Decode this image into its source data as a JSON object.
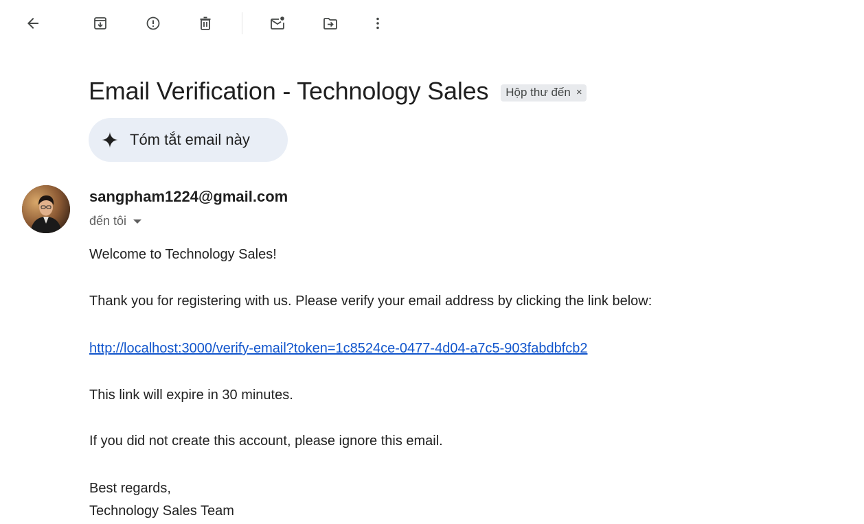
{
  "toolbar": {
    "icons": [
      "back-arrow-icon",
      "archive-icon",
      "report-spam-icon",
      "delete-icon",
      "mark-unread-icon",
      "move-to-icon",
      "more-options-icon"
    ]
  },
  "email": {
    "subject": "Email Verification - Technology Sales",
    "label": "Hộp thư đến",
    "label_remove": "×",
    "summarize_label": "Tóm tắt email này",
    "sender": "sangpham1224@gmail.com",
    "recipient": "đến tôi",
    "body": {
      "line1": "Welcome to Technology Sales!",
      "line2": "Thank you for registering with us. Please verify your email address by clicking the link below:",
      "link": "http://localhost:3000/verify-email?token=1c8524ce-0477-4d04-a7c5-903fabdbfcb2",
      "line3": "This link will expire in 30 minutes.",
      "line4": "If you did not create this account, please ignore this email.",
      "closing": "Best regards,",
      "signature": "Technology Sales Team"
    }
  },
  "colors": {
    "link": "#1155cc",
    "chip_bg": "#e8eaed",
    "summary_bg": "#e9eef6",
    "icon": "#444746"
  }
}
